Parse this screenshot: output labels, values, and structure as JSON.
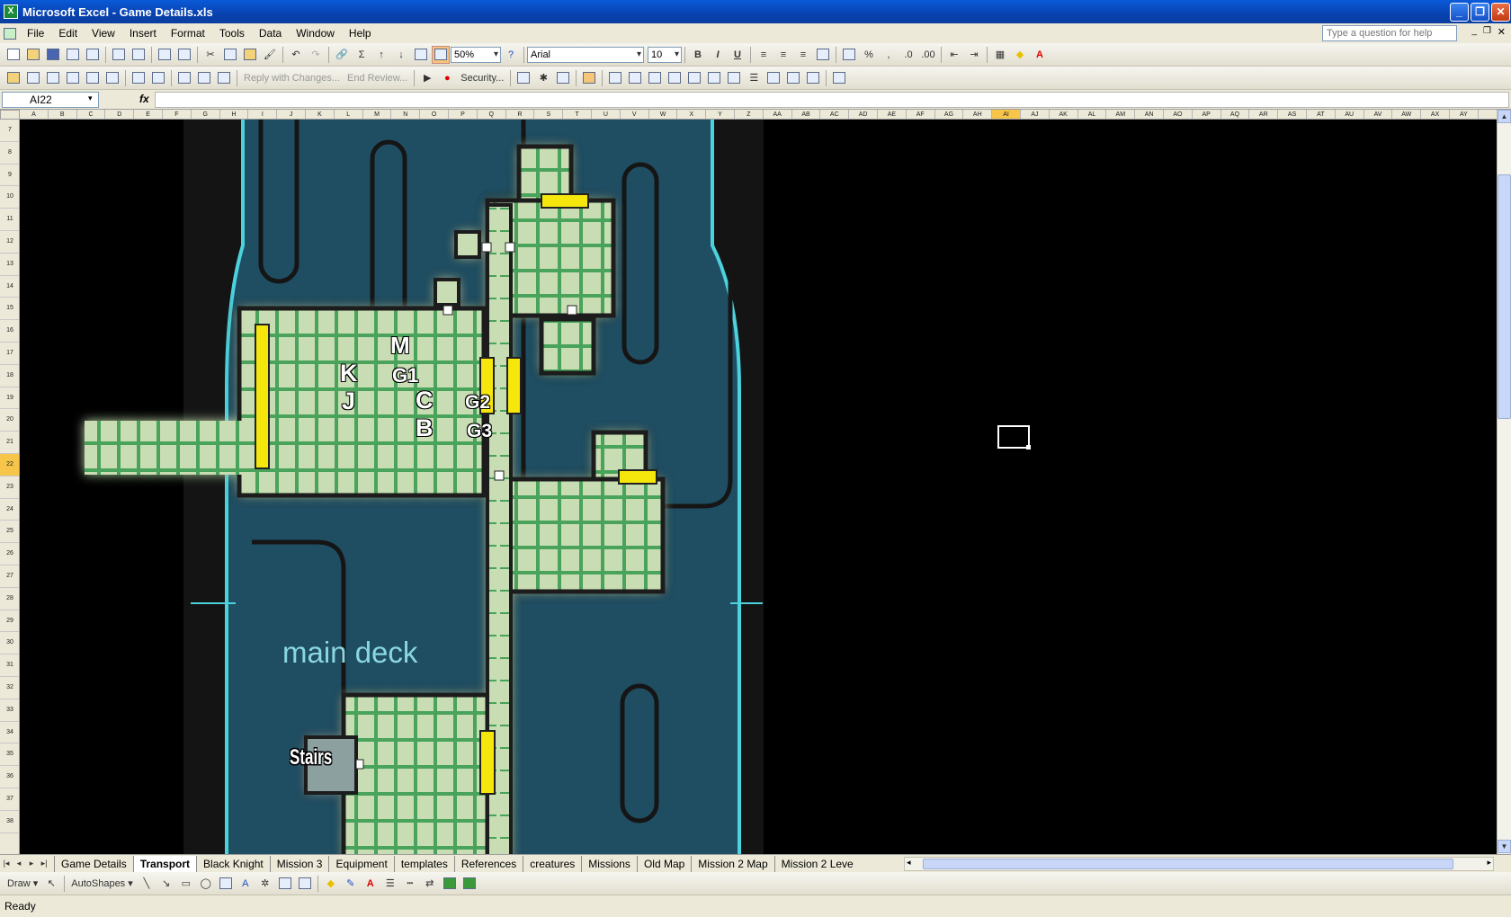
{
  "window": {
    "title": "Microsoft Excel - Game Details.xls",
    "minimize": "_",
    "restore": "❐",
    "close": "✕"
  },
  "menu": {
    "items": [
      "File",
      "Edit",
      "View",
      "Insert",
      "Format",
      "Tools",
      "Data",
      "Window",
      "Help"
    ],
    "help_placeholder": "Type a question for help"
  },
  "toolbar": {
    "zoom": "50%",
    "font": "Arial",
    "font_size": "10",
    "bold": "B",
    "italic": "I",
    "underline": "U",
    "reply_with_changes": "Reply with Changes...",
    "end_review": "End Review...",
    "security": "Security...",
    "autosum": "Σ",
    "percent": "%",
    "comma": ","
  },
  "formula": {
    "name_box": "AI22",
    "fx": "fx",
    "value": ""
  },
  "columns": [
    "A",
    "B",
    "C",
    "D",
    "E",
    "F",
    "G",
    "H",
    "I",
    "J",
    "K",
    "L",
    "M",
    "N",
    "O",
    "P",
    "Q",
    "R",
    "S",
    "T",
    "U",
    "V",
    "W",
    "X",
    "Y",
    "Z",
    "AA",
    "AB",
    "AC",
    "AD",
    "AE",
    "AF",
    "AG",
    "AH",
    "AI",
    "AJ",
    "AK",
    "AL",
    "AM",
    "AN",
    "AO",
    "AP",
    "AQ",
    "AR",
    "AS",
    "AT",
    "AU",
    "AV",
    "AW",
    "AX",
    "AY"
  ],
  "selected_column": "AI",
  "rows": [
    "7",
    "8",
    "9",
    "10",
    "11",
    "12",
    "13",
    "14",
    "15",
    "16",
    "17",
    "18",
    "19",
    "20",
    "21",
    "22",
    "23",
    "24",
    "25",
    "26",
    "27",
    "28",
    "29",
    "30",
    "31",
    "32",
    "33",
    "34",
    "35",
    "36",
    "37",
    "38"
  ],
  "selected_row": "22",
  "map": {
    "labels": {
      "m": "M",
      "k": "K",
      "g1": "G1",
      "j": "J",
      "c": "C",
      "g2": "G2",
      "b": "B",
      "g3": "G3"
    },
    "deck_name": "main deck",
    "stairs": "Stairs",
    "colors": {
      "hull": "#1f4e63",
      "hull_edge": "#4bd2dd",
      "floor": "#c9ddb4",
      "grid_line": "#4aa35a",
      "door": "#f5e60c",
      "wall": "#222222"
    }
  },
  "sheet_tabs": [
    "Game Details",
    "Transport",
    "Black Knight",
    "Mission 3",
    "Equipment",
    "templates",
    "References",
    "creatures",
    "Missions",
    "Old Map",
    "Mission 2 Map",
    "Mission 2 Leve"
  ],
  "active_tab": "Transport",
  "drawbar": {
    "draw": "Draw ▾",
    "autoshapes": "AutoShapes ▾"
  },
  "status": "Ready"
}
